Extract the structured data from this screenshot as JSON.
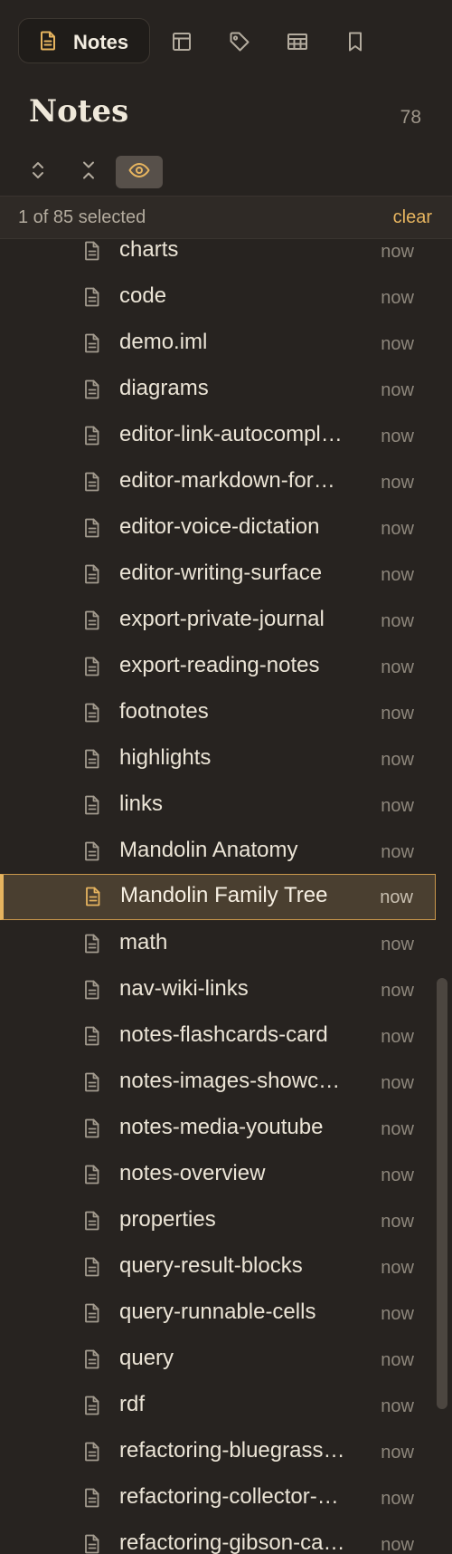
{
  "tabs": {
    "active_label": "Notes",
    "icons": [
      "note-icon",
      "layout-panel-icon",
      "tag-icon",
      "table-icon",
      "bookmark-icon"
    ]
  },
  "header": {
    "title": "Notes",
    "count": "78"
  },
  "selection": {
    "text": "1 of 85 selected",
    "clear_label": "clear"
  },
  "colors": {
    "background": "#272320",
    "accent": "#e6b45f",
    "selected_row": "#4a3f30"
  },
  "notes": [
    {
      "name": "charts",
      "time": "now"
    },
    {
      "name": "code",
      "time": "now"
    },
    {
      "name": "demo.iml",
      "time": "now"
    },
    {
      "name": "diagrams",
      "time": "now"
    },
    {
      "name": "editor-link-autocompl…",
      "time": "now"
    },
    {
      "name": "editor-markdown-for…",
      "time": "now"
    },
    {
      "name": "editor-voice-dictation",
      "time": "now"
    },
    {
      "name": "editor-writing-surface",
      "time": "now"
    },
    {
      "name": "export-private-journal",
      "time": "now"
    },
    {
      "name": "export-reading-notes",
      "time": "now"
    },
    {
      "name": "footnotes",
      "time": "now"
    },
    {
      "name": "highlights",
      "time": "now"
    },
    {
      "name": "links",
      "time": "now"
    },
    {
      "name": "Mandolin Anatomy",
      "time": "now"
    },
    {
      "name": "Mandolin Family Tree",
      "time": "now",
      "selected": true
    },
    {
      "name": "math",
      "time": "now"
    },
    {
      "name": "nav-wiki-links",
      "time": "now"
    },
    {
      "name": "notes-flashcards-card",
      "time": "now"
    },
    {
      "name": "notes-images-showc…",
      "time": "now"
    },
    {
      "name": "notes-media-youtube",
      "time": "now"
    },
    {
      "name": "notes-overview",
      "time": "now"
    },
    {
      "name": "properties",
      "time": "now"
    },
    {
      "name": "query-result-blocks",
      "time": "now"
    },
    {
      "name": "query-runnable-cells",
      "time": "now"
    },
    {
      "name": "query",
      "time": "now"
    },
    {
      "name": "rdf",
      "time": "now"
    },
    {
      "name": "refactoring-bluegrass…",
      "time": "now"
    },
    {
      "name": "refactoring-collector-…",
      "time": "now"
    },
    {
      "name": "refactoring-gibson-ca…",
      "time": "now"
    }
  ]
}
